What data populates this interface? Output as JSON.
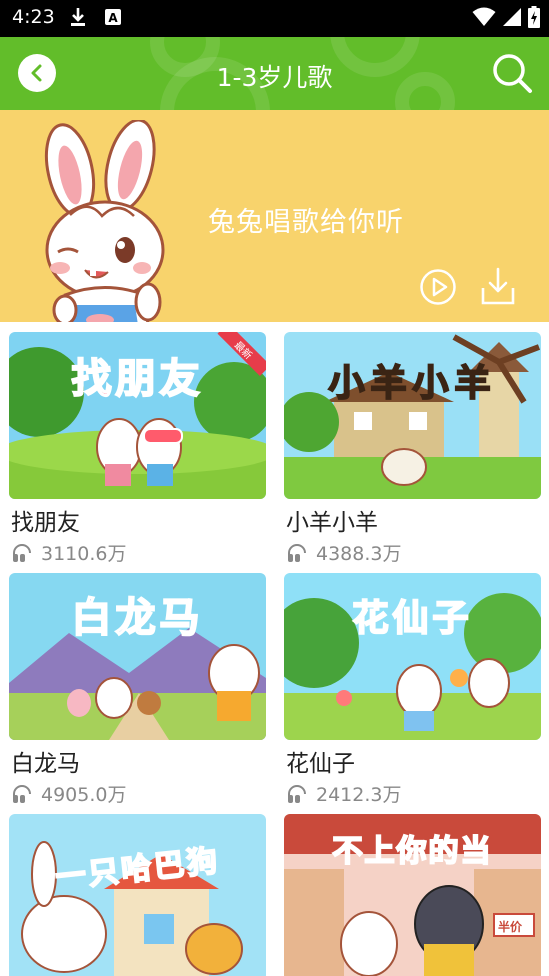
{
  "status_bar": {
    "time": "4:23"
  },
  "header": {
    "title": "1-3岁儿歌"
  },
  "banner": {
    "text": "兔兔唱歌给你听"
  },
  "colors": {
    "brand_green": "#62bd2a",
    "banner_yellow": "#f8d36c"
  },
  "icons": {
    "back": "chevron-left-icon",
    "search": "search-icon",
    "play": "play-icon",
    "download": "download-icon",
    "plays": "headphone-icon"
  },
  "songs": [
    {
      "title": "找朋友",
      "plays": "3110.6万",
      "thumb_title": "找朋友",
      "badge": "最新"
    },
    {
      "title": "小羊小羊",
      "plays": "4388.3万",
      "thumb_title": "小羊小羊"
    },
    {
      "title": "白龙马",
      "plays": "4905.0万",
      "thumb_title": "白龙马"
    },
    {
      "title": "花仙子",
      "plays": "2412.3万",
      "thumb_title": "花仙子"
    },
    {
      "title": "",
      "plays": "",
      "thumb_title": "一只哈巴狗"
    },
    {
      "title": "",
      "plays": "",
      "thumb_title": "不上你的当",
      "thumb_sign": "半价"
    }
  ]
}
